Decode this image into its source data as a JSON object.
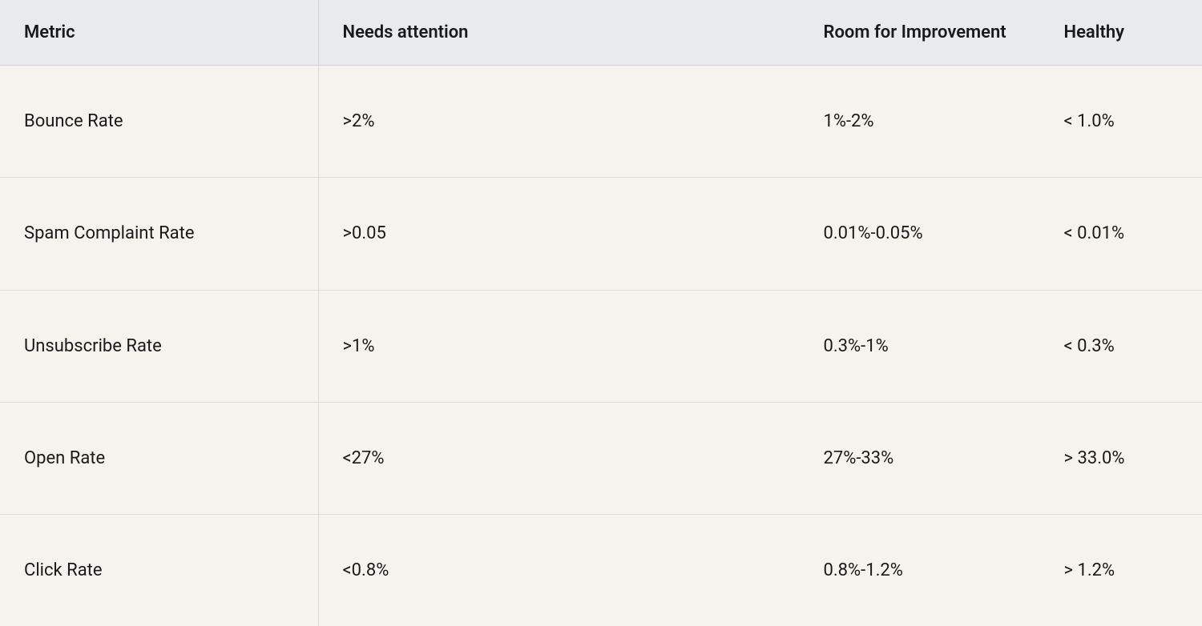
{
  "table": {
    "headers": {
      "metric": "Metric",
      "needs_attention": "Needs attention",
      "room_for_improvement": "Room for Improvement",
      "healthy": "Healthy"
    },
    "rows": [
      {
        "metric": "Bounce Rate",
        "needs_attention": ">2%",
        "room_for_improvement": "1%-2%",
        "healthy": "< 1.0%"
      },
      {
        "metric": "Spam Complaint Rate",
        "needs_attention": ">0.05",
        "room_for_improvement": "0.01%-0.05%",
        "healthy": "< 0.01%"
      },
      {
        "metric": "Unsubscribe Rate",
        "needs_attention": ">1%",
        "room_for_improvement": "0.3%-1%",
        "healthy": "< 0.3%"
      },
      {
        "metric": "Open Rate",
        "needs_attention": "<27%",
        "room_for_improvement": "27%-33%",
        "healthy": "> 33.0%"
      },
      {
        "metric": "Click Rate",
        "needs_attention": "<0.8%",
        "room_for_improvement": "0.8%-1.2%",
        "healthy": "> 1.2%"
      }
    ]
  }
}
